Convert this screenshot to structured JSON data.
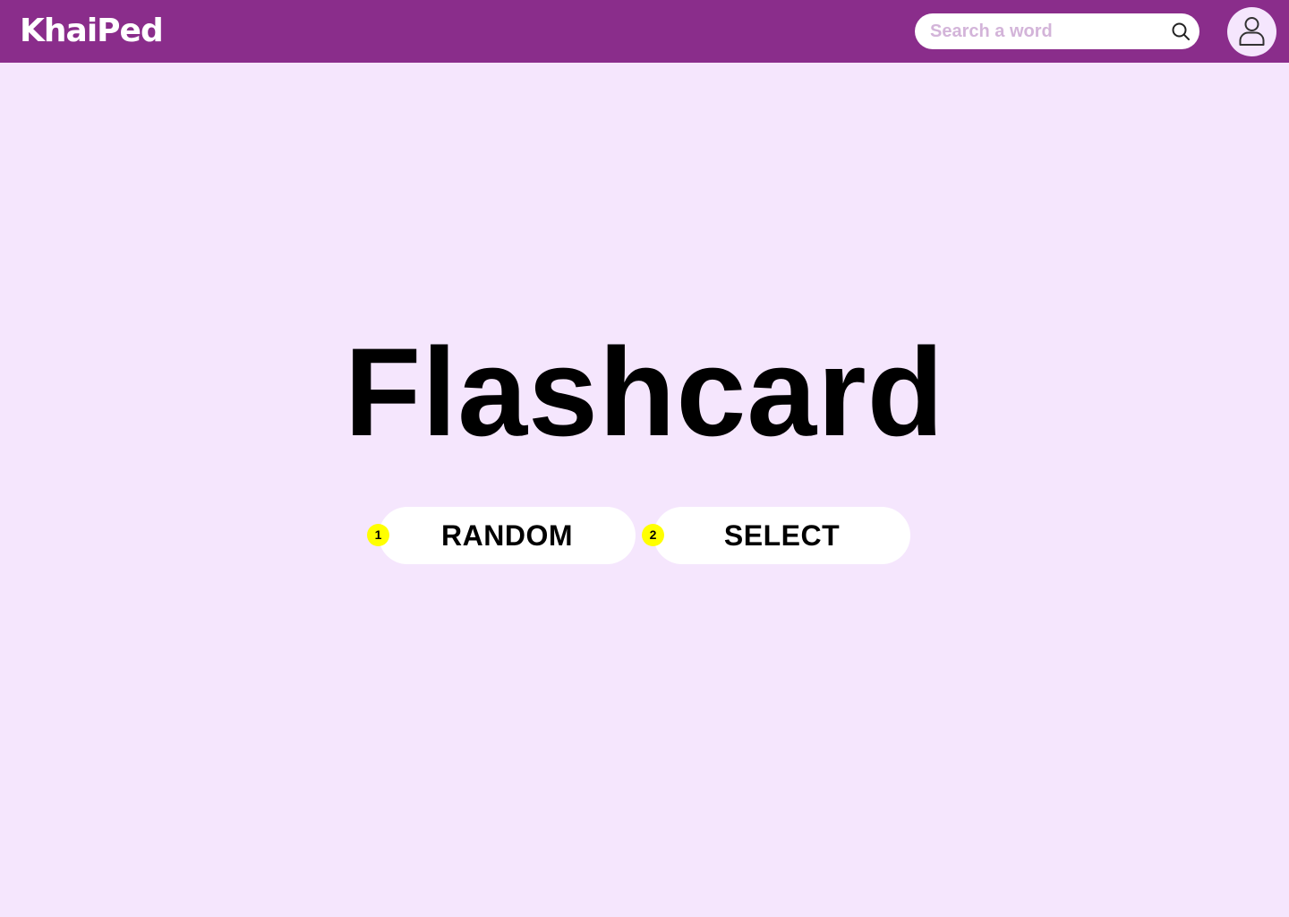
{
  "header": {
    "logo": "KhaiPed",
    "search": {
      "placeholder": "Search a word",
      "value": "",
      "icon": "search-icon"
    },
    "avatar": {
      "icon": "user-icon"
    }
  },
  "main": {
    "title": "Flashcard",
    "buttons": [
      {
        "badge": "1",
        "label": "RANDOM"
      },
      {
        "badge": "2",
        "label": "SELECT"
      }
    ]
  },
  "colors": {
    "header_bg": "#8A2D8B",
    "page_bg": "#F5E6FD",
    "button_bg": "#FFFFFF",
    "badge_bg": "#FFFF00",
    "placeholder": "#D3B4D9"
  }
}
